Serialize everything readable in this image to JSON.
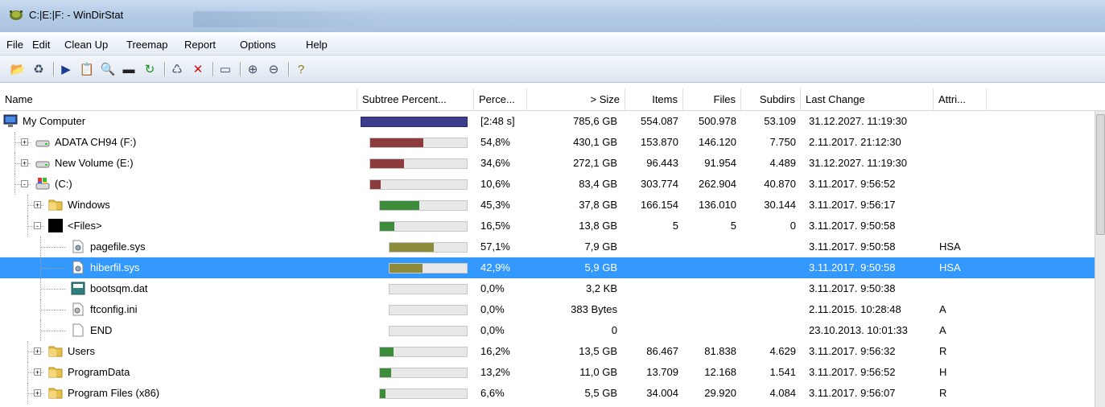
{
  "window": {
    "title": "C:|E:|F: - WinDirStat"
  },
  "menu": [
    "File",
    "Edit",
    "Clean Up",
    "Treemap",
    "Report",
    "Options",
    "Help"
  ],
  "toolbar": [
    {
      "icon": "open-folder-icon",
      "glyph": "📂"
    },
    {
      "icon": "refresh-icon",
      "glyph": "♻"
    },
    {
      "sep": true
    },
    {
      "icon": "play-icon",
      "glyph": "▶"
    },
    {
      "icon": "copy-path-icon",
      "glyph": "📋"
    },
    {
      "icon": "explorer-icon",
      "glyph": "🔍"
    },
    {
      "icon": "command-prompt-icon",
      "glyph": "▬"
    },
    {
      "icon": "refresh-green-icon",
      "glyph": "↻"
    },
    {
      "sep": true
    },
    {
      "icon": "recycle-bin-icon",
      "glyph": "♺"
    },
    {
      "icon": "delete-icon",
      "glyph": "✕"
    },
    {
      "sep": true
    },
    {
      "icon": "properties-icon",
      "glyph": "▭"
    },
    {
      "sep": true
    },
    {
      "icon": "zoom-in-icon",
      "glyph": "⊕"
    },
    {
      "icon": "zoom-out-icon",
      "glyph": "⊖"
    },
    {
      "sep": true
    },
    {
      "icon": "help-icon",
      "glyph": "?"
    }
  ],
  "columns": {
    "name": "Name",
    "subtree": "Subtree Percent...",
    "percent": "Perce...",
    "size": "> Size",
    "items": "Items",
    "files": "Files",
    "subdirs": "Subdirs",
    "last_change": "Last Change",
    "attributes": "Attri..."
  },
  "rows": [
    {
      "name": "My Computer",
      "icon": "computer-icon",
      "level": 0,
      "expander": "",
      "bar": 1.0,
      "bar_color": "#3c3c8c",
      "percent": "[2:48 s]",
      "size": "785,6 GB",
      "items": "554.087",
      "files": "500.978",
      "subdirs": "53.109",
      "last_change": "31.12.2027. 11:19:30",
      "attr": ""
    },
    {
      "name": "ADATA CH94 (F:)",
      "icon": "drive-icon",
      "level": 1,
      "expander": "+",
      "bar": 0.548,
      "bar_color": "#8c3c3c",
      "percent": "54,8%",
      "size": "430,1 GB",
      "items": "153.870",
      "files": "146.120",
      "subdirs": "7.750",
      "last_change": "2.11.2017. 21:12:30",
      "attr": ""
    },
    {
      "name": "New Volume (E:)",
      "icon": "drive-icon",
      "level": 1,
      "expander": "+",
      "bar": 0.346,
      "bar_color": "#8c3c3c",
      "percent": "34,6%",
      "size": "272,1 GB",
      "items": "96.443",
      "files": "91.954",
      "subdirs": "4.489",
      "last_change": "31.12.2027. 11:19:30",
      "attr": ""
    },
    {
      "name": "(C:)",
      "icon": "system-drive-icon",
      "level": 1,
      "expander": "-",
      "bar": 0.106,
      "bar_color": "#8c3c3c",
      "percent": "10,6%",
      "size": "83,4 GB",
      "items": "303.774",
      "files": "262.904",
      "subdirs": "40.870",
      "last_change": "3.11.2017. 9:56:52",
      "attr": ""
    },
    {
      "name": "Windows",
      "icon": "folder-icon",
      "level": 2,
      "expander": "+",
      "bar": 0.453,
      "bar_color": "#3c8c3c",
      "percent": "45,3%",
      "size": "37,8 GB",
      "items": "166.154",
      "files": "136.010",
      "subdirs": "30.144",
      "last_change": "3.11.2017. 9:56:17",
      "attr": ""
    },
    {
      "name": "<Files>",
      "icon": "files-block-icon",
      "level": 2,
      "expander": "-",
      "bar": 0.165,
      "bar_color": "#3c8c3c",
      "percent": "16,5%",
      "size": "13,8 GB",
      "items": "5",
      "files": "5",
      "subdirs": "0",
      "last_change": "3.11.2017. 9:50:58",
      "attr": ""
    },
    {
      "name": "pagefile.sys",
      "icon": "system-file-icon",
      "level": 3,
      "expander": "",
      "bar": 0.571,
      "bar_color": "#8c8c3c",
      "percent": "57,1%",
      "size": "7,9 GB",
      "items": "",
      "files": "",
      "subdirs": "",
      "last_change": "3.11.2017. 9:50:58",
      "attr": "HSA"
    },
    {
      "name": "hiberfil.sys",
      "icon": "system-file-icon",
      "level": 3,
      "expander": "",
      "bar": 0.429,
      "bar_color": "#8c8c3c",
      "percent": "42,9%",
      "size": "5,9 GB",
      "items": "",
      "files": "",
      "subdirs": "",
      "last_change": "3.11.2017. 9:50:58",
      "attr": "HSA",
      "selected": true
    },
    {
      "name": "bootsqm.dat",
      "icon": "dat-file-icon",
      "level": 3,
      "expander": "",
      "bar": 0.0,
      "bar_color": "#8c8c3c",
      "percent": "0,0%",
      "size": "3,2 KB",
      "items": "",
      "files": "",
      "subdirs": "",
      "last_change": "3.11.2017. 9:50:38",
      "attr": ""
    },
    {
      "name": "ftconfig.ini",
      "icon": "ini-file-icon",
      "level": 3,
      "expander": "",
      "bar": 0.0,
      "bar_color": "#8c8c3c",
      "percent": "0,0%",
      "size": "383 Bytes",
      "items": "",
      "files": "",
      "subdirs": "",
      "last_change": "2.11.2015. 10:28:48",
      "attr": "A"
    },
    {
      "name": "END",
      "icon": "blank-file-icon",
      "level": 3,
      "expander": "",
      "bar": 0.0,
      "bar_color": "#8c8c3c",
      "percent": "0,0%",
      "size": "0",
      "items": "",
      "files": "",
      "subdirs": "",
      "last_change": "23.10.2013. 10:01:33",
      "attr": "A"
    },
    {
      "name": "Users",
      "icon": "folder-icon",
      "level": 2,
      "expander": "+",
      "bar": 0.162,
      "bar_color": "#3c8c3c",
      "percent": "16,2%",
      "size": "13,5 GB",
      "items": "86.467",
      "files": "81.838",
      "subdirs": "4.629",
      "last_change": "3.11.2017. 9:56:32",
      "attr": "R"
    },
    {
      "name": "ProgramData",
      "icon": "folder-icon",
      "level": 2,
      "expander": "+",
      "bar": 0.132,
      "bar_color": "#3c8c3c",
      "percent": "13,2%",
      "size": "11,0 GB",
      "items": "13.709",
      "files": "12.168",
      "subdirs": "1.541",
      "last_change": "3.11.2017. 9:56:52",
      "attr": "H"
    },
    {
      "name": "Program Files (x86)",
      "icon": "folder-icon",
      "level": 2,
      "expander": "+",
      "bar": 0.066,
      "bar_color": "#3c8c3c",
      "percent": "6,6%",
      "size": "5,5 GB",
      "items": "34.004",
      "files": "29.920",
      "subdirs": "4.084",
      "last_change": "3.11.2017. 9:56:07",
      "attr": "R"
    }
  ]
}
